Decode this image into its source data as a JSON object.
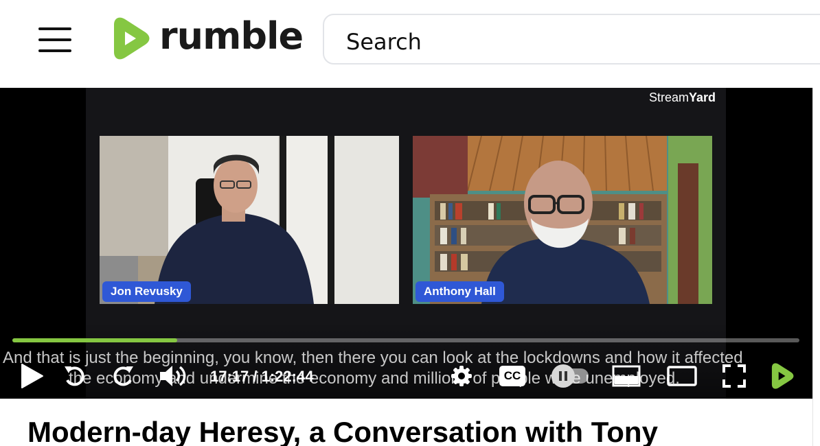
{
  "header": {
    "logo_text": "rumble",
    "search_placeholder": "Search"
  },
  "player": {
    "watermark_prefix": "Stream",
    "watermark_suffix": "Yard",
    "participants": [
      {
        "name": "Jon Revusky"
      },
      {
        "name": "Anthony Hall"
      }
    ],
    "progress": 0.2095,
    "caption_lines": [
      "And that is just the beginning, you know, then there you can look at the lockdowns and how it affected",
      "the economy and undermine the economy and millions of people were unemployed."
    ],
    "time_display": "17:17 / 1:22:44",
    "cc_label": "CC",
    "icons": [
      "play-icon",
      "rewind-icon",
      "forward-icon",
      "volume-icon",
      "gear-icon",
      "cc-icon",
      "autoplay-toggle",
      "miniplayer-icon",
      "theater-icon",
      "fullscreen-icon",
      "rumble-icon"
    ],
    "accent_color": "#85c742"
  },
  "video": {
    "title": "Modern-day Heresy, a Conversation with Tony"
  }
}
